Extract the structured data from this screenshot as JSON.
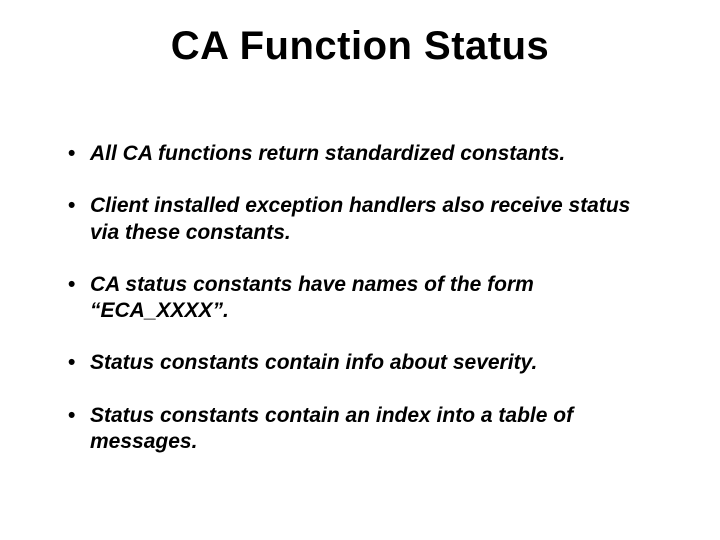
{
  "title": "CA Function Status",
  "bullets": [
    "All CA functions return standardized constants.",
    "Client installed exception handlers also receive status via these  constants.",
    "CA status constants have names of the form “ECA_XXXX”.",
    "Status constants contain info about severity.",
    "Status constants contain an index into a table of messages."
  ]
}
